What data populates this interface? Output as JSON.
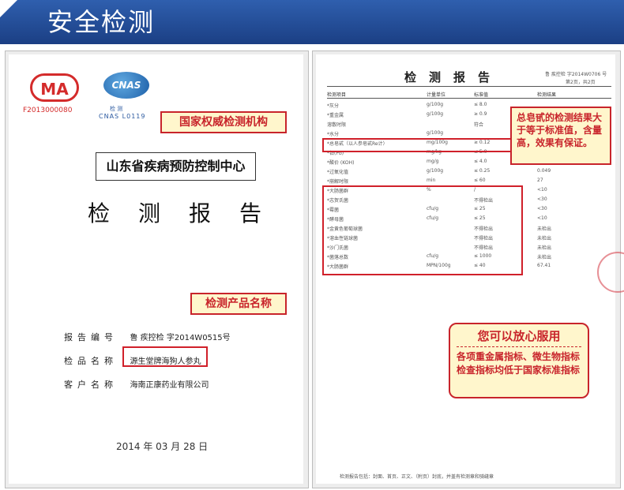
{
  "header": {
    "title": "安全检测"
  },
  "left_doc": {
    "ma_logo": "MA",
    "ma_code": "F2013000080",
    "cnas_logo": "CNAS",
    "cnas_small": "检 测",
    "cnas_text": "CNAS   L0119",
    "org_name": "山东省疾病预防控制中心",
    "report_title": "检测报告",
    "fields": [
      {
        "label": "报告编号",
        "value": "鲁 疾控检 字2014W0515号"
      },
      {
        "label": "检品名称",
        "value": "源生堂牌海狗人参丸"
      },
      {
        "label": "客户名称",
        "value": "海南正康药业有限公司"
      }
    ],
    "date": "2014 年 03 月 28 日"
  },
  "callouts": {
    "authority": "国家权威检测机构",
    "product": "检测产品名称",
    "saponin": "总皂甙的检测结果大于等于标准值，含量高，效果有保证。",
    "assurance_title": "您可以放心服用",
    "assurance_body": "各项重金属指标、微生物指标检查指标均低于国家标准指标"
  },
  "right_doc": {
    "title": "检测报告",
    "meta_line": "鲁 疾控检 字2014W0706  号",
    "page_line": "第2页，共2页",
    "headers": [
      "检测项目",
      "计量单位",
      "标准值",
      "检测结果"
    ],
    "rows": [
      [
        "*灰分",
        "g/100g",
        "≤ 8.0",
        ""
      ],
      [
        "*重金属",
        "g/100g",
        "≥ 0.9",
        ""
      ],
      [
        "溶散时限",
        "",
        "符合",
        ""
      ],
      [
        "*水分",
        "g/100g",
        "",
        ""
      ],
      [
        "*总皂甙（以人参皂甙Re计）",
        "mg/100g",
        "≥ 0.12",
        ""
      ],
      [
        "*铅(Pb)",
        "mg/kg",
        "≤ 5.0",
        ""
      ],
      [
        "*酸价 (KOH)",
        "mg/g",
        "≤ 4.0",
        ""
      ],
      [
        "*过氧化值",
        "g/100g",
        "≤ 0.25",
        "0.049"
      ],
      [
        "*崩解时限",
        "min",
        "≤ 60",
        "27"
      ],
      [
        "*大肠菌群",
        "%",
        "/",
        "<10"
      ],
      [
        "*志贺氏菌",
        "",
        "不得检出",
        "<30"
      ],
      [
        "*霉菌",
        "cfu/g",
        "≤ 25",
        "<30"
      ],
      [
        "*酵母菌",
        "cfu/g",
        "≤ 25",
        "<10"
      ],
      [
        "*金黄色葡萄球菌",
        "",
        "不得检出",
        "未检出"
      ],
      [
        "*溶血性链球菌",
        "",
        "不得检出",
        "未检出"
      ],
      [
        "*沙门氏菌",
        "",
        "不得检出",
        "未检出"
      ],
      [
        "*菌落总数",
        "cfu/g",
        "≤ 1000",
        "未检出"
      ],
      [
        "*大肠菌群",
        "MPN/100g",
        "≤ 40",
        "67.41"
      ]
    ],
    "footer": "检测报告包括：封面、首页、正文、（附页）封底，并盖有检测章和骑缝章"
  }
}
